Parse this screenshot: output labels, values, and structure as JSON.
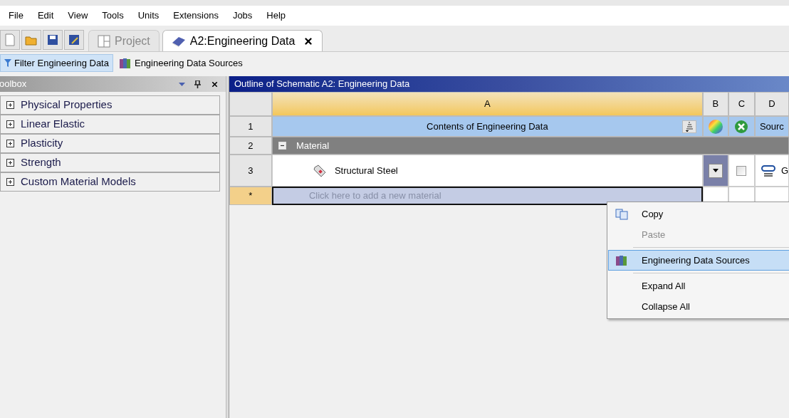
{
  "menu_bar": [
    "File",
    "Edit",
    "View",
    "Tools",
    "Units",
    "Extensions",
    "Jobs",
    "Help"
  ],
  "tabs": [
    {
      "label": "Project",
      "selected": false
    },
    {
      "label": "A2:Engineering Data",
      "selected": true
    }
  ],
  "filter_bar": [
    {
      "label": "Filter Engineering Data",
      "selected": true,
      "kind": "filter"
    },
    {
      "label": "Engineering Data Sources",
      "selected": false,
      "kind": "books"
    }
  ],
  "toolbox": {
    "title": "oolbox",
    "items": [
      {
        "label": "Physical Properties",
        "expanded": false
      },
      {
        "label": "Linear Elastic",
        "expanded": false
      },
      {
        "label": "Plasticity",
        "expanded": false
      },
      {
        "label": "Strength",
        "expanded": false
      },
      {
        "label": "Custom Material Models",
        "expanded": false
      }
    ]
  },
  "outline": {
    "title": "Outline of Schematic A2: Engineering Data",
    "columns": [
      "A",
      "B",
      "C",
      "D"
    ],
    "rows": [
      {
        "kind": "heading",
        "number": "1",
        "label": "Contents of Engineering Data",
        "source": "Sourc"
      },
      {
        "kind": "group",
        "number": "2",
        "label": "Material",
        "expanded": true
      },
      {
        "kind": "material",
        "number": "3",
        "label": "Structural Steel",
        "checked": false,
        "source": "G"
      },
      {
        "kind": "new",
        "number": "*",
        "placeholder": "Click here to add a new material"
      }
    ]
  },
  "context_menu": [
    {
      "kind": "copy",
      "label": "Copy",
      "disabled": false,
      "selected": false
    },
    {
      "kind": "plain",
      "label": "Paste",
      "disabled": true,
      "selected": false
    },
    {
      "kind": "separator"
    },
    {
      "kind": "books",
      "label": "Engineering Data Sources",
      "disabled": false,
      "selected": true
    },
    {
      "kind": "separator"
    },
    {
      "kind": "plain",
      "label": "Expand All",
      "disabled": false,
      "selected": false
    },
    {
      "kind": "plain",
      "label": "Collapse All",
      "disabled": false,
      "selected": false
    }
  ]
}
